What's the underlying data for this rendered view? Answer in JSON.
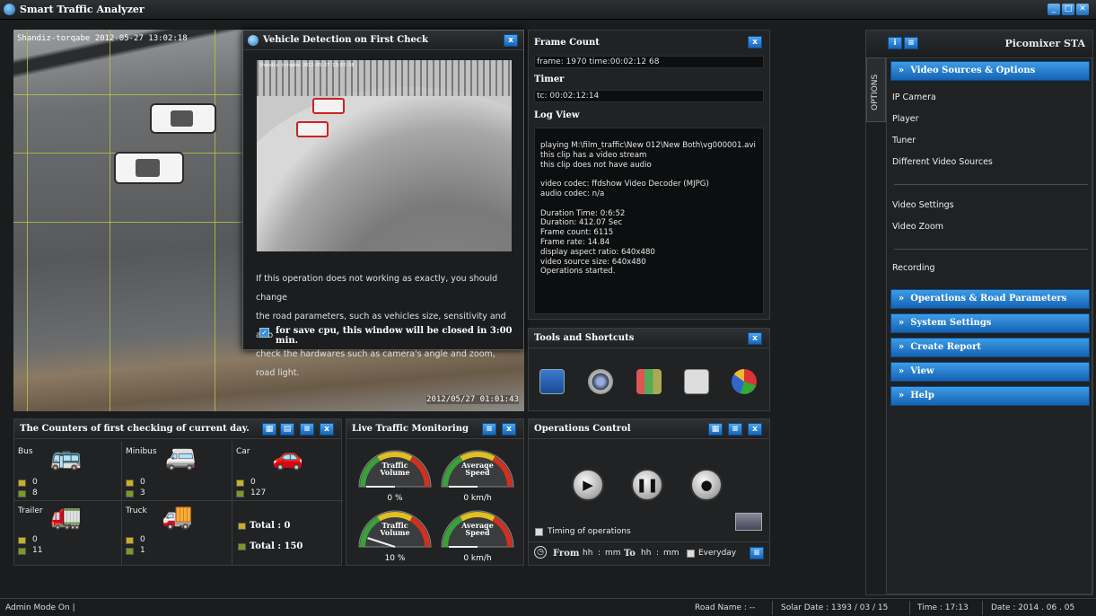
{
  "window": {
    "title": "Smart Traffic Analyzer"
  },
  "video": {
    "stamp": "Shandiz-torqabe  2012-05-27      13:02:18",
    "stamp2": "2012/05/27 01:01:43"
  },
  "popup": {
    "title": "Vehicle Detection on First Check",
    "stamp": "Shandiz-torqabe  2012-05-27   13:02:18",
    "text": [
      "If this operation does not working as exactly, you should change",
      "the road parameters, such as vehicles size, sensitivity and also",
      "check the hardwares such as camera's angle and zoom, road light."
    ],
    "checkbox_label": "for save cpu, this window will be closed in 3:00 min."
  },
  "info": {
    "frame_count_title": "Frame Count",
    "frame_value": "frame: 1970 time:00:02:12 68",
    "timer_title": "Timer",
    "timer_value": "tc: 00:02:12:14",
    "log_title": "Log View",
    "log_lines": [
      "playing M:\\film_traffic\\New 012\\New Both\\vg000001.avi",
      "this clip has a video stream",
      "this clip does not have audio",
      "",
      "video codec: ffdshow Video Decoder (MJPG)",
      "audio codec: n/a",
      "",
      "Duration Time: 0:6:52",
      "Duration: 412.07 Sec",
      "Frame count: 6115",
      "Frame rate: 14.84",
      "display aspect ratio: 640x480",
      "video source size: 640x480",
      "Operations started."
    ]
  },
  "tools": {
    "title": "Tools and Shortcuts"
  },
  "counters": {
    "title": "The Counters of first checking of current day.",
    "cells": [
      {
        "label": "Bus",
        "v1": "0",
        "v2": "8"
      },
      {
        "label": "Minibus",
        "v1": "0",
        "v2": "3"
      },
      {
        "label": "Car",
        "v1": "0",
        "v2": "127"
      },
      {
        "label": "Trailer",
        "v1": "0",
        "v2": "11"
      },
      {
        "label": "Truck",
        "v1": "0",
        "v2": "1"
      }
    ],
    "total1": "Total : 0",
    "total2": "Total : 150"
  },
  "monitoring": {
    "title": "Live Traffic Monitoring",
    "gauges": [
      {
        "label1": "Traffic",
        "label2": "Volume",
        "value": "0 %",
        "level": 0.0
      },
      {
        "label1": "Average",
        "label2": "Speed",
        "value": "0 km/h",
        "level": 0.0
      },
      {
        "label1": "Traffic",
        "label2": "Volume",
        "value": "10 %",
        "level": 0.1
      },
      {
        "label1": "Average",
        "label2": "Speed",
        "value": "0 km/h",
        "level": 0.0
      }
    ]
  },
  "operations": {
    "title": "Operations Control",
    "timing_label": "Timing of operations",
    "from_label": "From",
    "to_label": "To",
    "hh": "hh",
    "mm": "mm",
    "everyday": "Everyday"
  },
  "right": {
    "title": "Picomixer STA",
    "options_tab": "OPTIONS",
    "video_sources": "Video Sources & Options",
    "items": [
      "IP Camera",
      "Player",
      "Tuner",
      "Different Video Sources"
    ],
    "items2": [
      "Video Settings",
      "Video Zoom"
    ],
    "items3": [
      "Recording"
    ],
    "sections": [
      "Operations & Road Parameters",
      "System Settings",
      "Create Report",
      "View",
      "Help"
    ]
  },
  "status": {
    "mode": "Admin Mode On |",
    "road": "Road Name : --",
    "solar": "Solar Date :  1393 / 03 / 15",
    "time": "Time :  17:13",
    "date": "Date :  2014 . 06 . 05"
  }
}
